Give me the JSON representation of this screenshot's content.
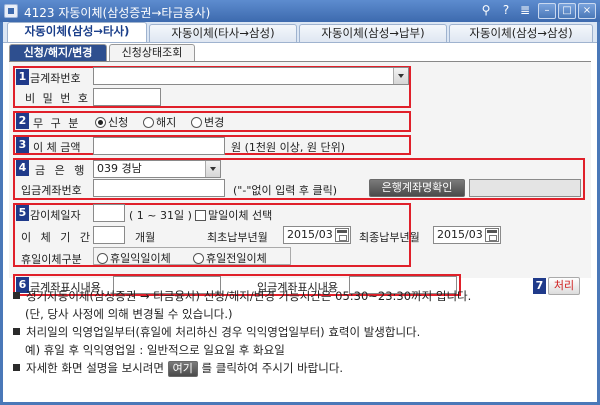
{
  "window": {
    "title": "4123 자동이체(삼성증권→타금융사)",
    "pin_glyph": "⚲",
    "help_label": "?",
    "menu_label": "≣",
    "min_glyph": "–",
    "max_glyph": "□",
    "close_glyph": "×"
  },
  "tabs": [
    {
      "label": "자동이체(삼성→타사)"
    },
    {
      "label": "자동이체(타사→삼성)"
    },
    {
      "label": "자동이체(삼성→납부)"
    },
    {
      "label": "자동이체(삼성→삼성)"
    }
  ],
  "subtabs": [
    {
      "label": "신청/해지/변경"
    },
    {
      "label": "신청상태조회"
    }
  ],
  "sections": {
    "s1": {
      "num": "1",
      "account_label": "금계좌번호",
      "account_value": "",
      "password_label": "비 밀 번 호"
    },
    "s2": {
      "num": "2",
      "label": "무 구 분",
      "options": [
        "신청",
        "해지",
        "변경"
      ],
      "selected": 0
    },
    "s3": {
      "num": "3",
      "label": "이 체 금액",
      "unit_note": "원 (1천원 이상, 원 단위)"
    },
    "s4": {
      "num": "4",
      "bank_label": "금 은 행",
      "bank_value": "039 경남",
      "in_account_label": "입금계좌번호",
      "in_account_note": "(\"-\"없이 입력 후 클릭)",
      "check_button": "은행계좌명확인"
    },
    "s5": {
      "num": "5",
      "day_label": "감이체일자",
      "day_range": "( 1 ~ 31일 )",
      "last_day_label": "말일이체 선택",
      "period_label": "이 체 기 간",
      "month_unit": "개월",
      "first_label": "최초납부년월",
      "first_value": "2015/03",
      "last_label": "최종납부년월",
      "last_value": "2015/03",
      "holiday_label": "휴일이체구분",
      "holiday_options": [
        "휴일익일이체",
        "휴일전일이체"
      ]
    },
    "s6": {
      "num": "6",
      "out_label": "금계좌표시내용",
      "in_label": "입금계좌표시내용"
    },
    "s7": {
      "num": "7",
      "process_button": "처리"
    }
  },
  "notes": {
    "n1": "정기자동이체(삼성증권 → 타금융사) 신청/해지/변경 가능시간은 05:30~23:30까지 입니다.",
    "n1b": "(단, 당사 사정에 의해 변경될 수 있습니다.)",
    "n2": "처리일의 익영업일부터(휴일에 처리하신 경우 익익영업일부터) 효력이 발생합니다.",
    "n2b": "예) 휴일 후 익익영업일 : 일반적으로 일요일 후 화요일",
    "n3_pre": "자세한 화면 설명을 보시려면",
    "n3_button": "여기",
    "n3_post": "를 클릭하여 주시기 바랍니다."
  }
}
